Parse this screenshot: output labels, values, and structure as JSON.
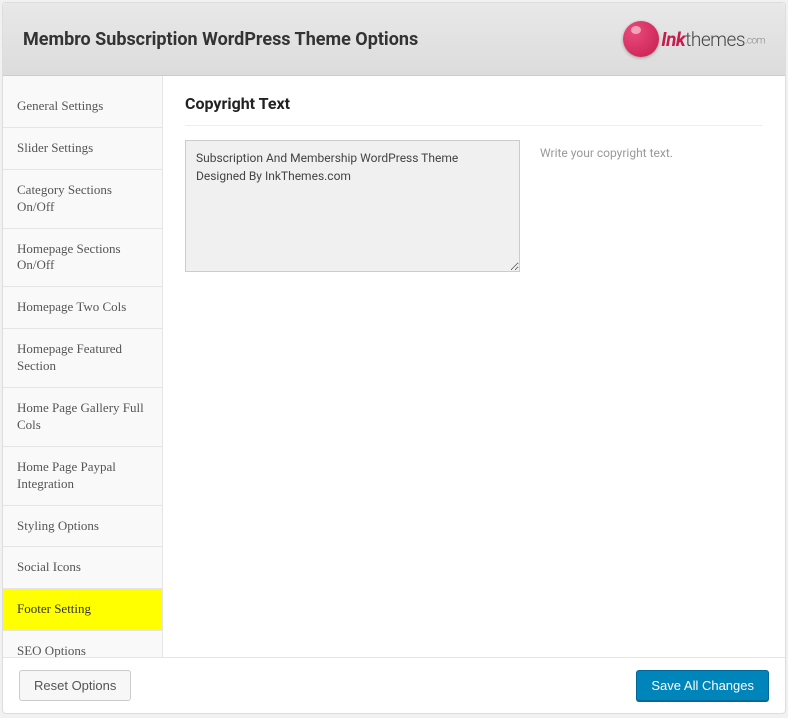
{
  "header": {
    "title": "Membro Subscription WordPress Theme Options",
    "logo_ink": "Ink",
    "logo_themes": "themes",
    "logo_dotcom": ".com"
  },
  "sidebar": {
    "items": [
      {
        "label": "General Settings",
        "active": false
      },
      {
        "label": "Slider Settings",
        "active": false
      },
      {
        "label": "Category Sections On/Off",
        "active": false
      },
      {
        "label": "Homepage Sections On/Off",
        "active": false
      },
      {
        "label": "Homepage Two Cols",
        "active": false
      },
      {
        "label": "Homepage Featured Section",
        "active": false
      },
      {
        "label": "Home Page Gallery Full Cols",
        "active": false
      },
      {
        "label": "Home Page Paypal Integration",
        "active": false
      },
      {
        "label": "Styling Options",
        "active": false
      },
      {
        "label": "Social Icons",
        "active": false
      },
      {
        "label": "Footer Setting",
        "active": true
      },
      {
        "label": "SEO Options",
        "active": false
      }
    ]
  },
  "content": {
    "section_title": "Copyright Text",
    "textarea_value": "Subscription And Membership WordPress Theme Designed By InkThemes.com",
    "help_text": "Write your copyright text."
  },
  "footer": {
    "reset_label": "Reset Options",
    "save_label": "Save All Changes"
  }
}
